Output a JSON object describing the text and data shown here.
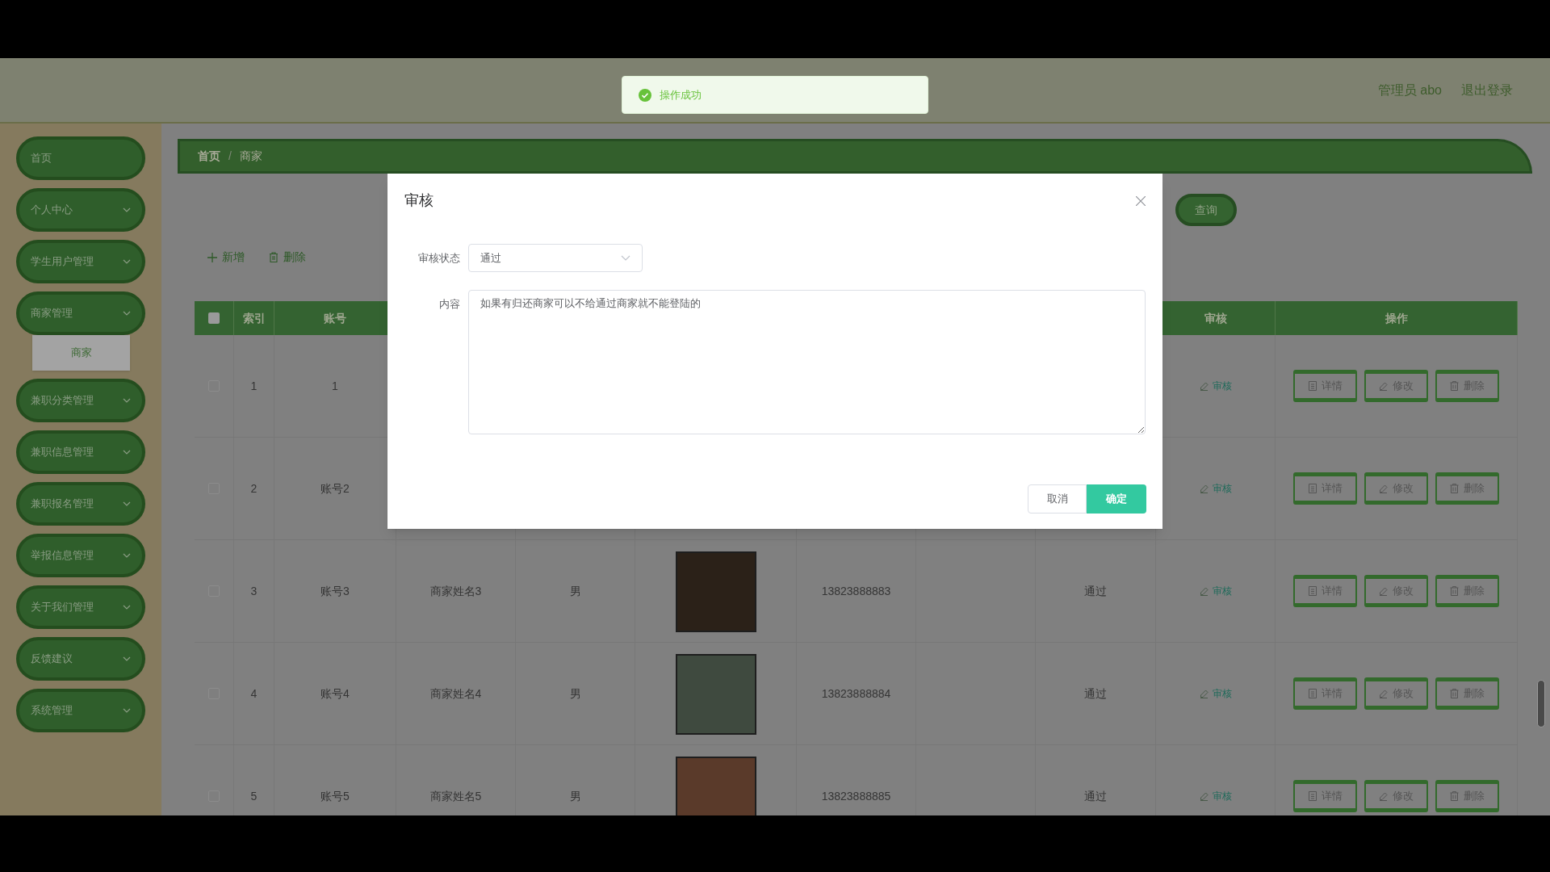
{
  "header": {
    "user": "管理员 abo",
    "logout": "退出登录"
  },
  "toast": {
    "message": "操作成功"
  },
  "sidebar": {
    "items": [
      {
        "label": "首页",
        "has_submenu": false
      },
      {
        "label": "个人中心",
        "has_submenu": true
      },
      {
        "label": "学生用户管理",
        "has_submenu": true
      },
      {
        "label": "商家管理",
        "has_submenu": true,
        "children": [
          {
            "label": "商家",
            "selected": true
          }
        ]
      },
      {
        "label": "兼职分类管理",
        "has_submenu": true
      },
      {
        "label": "兼职信息管理",
        "has_submenu": true
      },
      {
        "label": "兼职报名管理",
        "has_submenu": true
      },
      {
        "label": "举报信息管理",
        "has_submenu": true
      },
      {
        "label": "关于我们管理",
        "has_submenu": true
      },
      {
        "label": "反馈建议",
        "has_submenu": true
      },
      {
        "label": "系统管理",
        "has_submenu": true
      }
    ]
  },
  "breadcrumb": {
    "items": [
      "首页",
      "商家"
    ],
    "separator": "/"
  },
  "search": {
    "button": "查询"
  },
  "toolbar": {
    "add": "新增",
    "delete": "删除"
  },
  "table": {
    "select_all": {
      "checked": false
    },
    "columns": {
      "index": "索引",
      "account": "账号",
      "review": "审核",
      "actions": "操作"
    },
    "rows": [
      {
        "checked": false,
        "index": "1",
        "account": "1",
        "review": "审核",
        "actions": [
          "详情",
          "修改",
          "删除"
        ]
      },
      {
        "checked": false,
        "index": "2",
        "account": "账号2",
        "review": "审核",
        "actions": [
          "详情",
          "修改",
          "删除"
        ]
      },
      {
        "checked": false,
        "index": "3",
        "account": "账号3",
        "name": "商家姓名3",
        "gender": "男",
        "has_photo": true,
        "phone": "13823888883",
        "status": "通过",
        "review": "审核",
        "actions": [
          "详情",
          "修改",
          "删除"
        ]
      },
      {
        "checked": false,
        "index": "4",
        "account": "账号4",
        "name": "商家姓名4",
        "gender": "男",
        "has_photo": true,
        "phone": "13823888884",
        "status": "通过",
        "review": "审核",
        "actions": [
          "详情",
          "修改",
          "删除"
        ]
      },
      {
        "checked": false,
        "index": "5",
        "account": "账号5",
        "name": "商家姓名5",
        "gender": "男",
        "has_photo": true,
        "phone": "13823888885",
        "status": "通过",
        "review": "审核",
        "actions": [
          "详情",
          "修改",
          "删除"
        ]
      }
    ]
  },
  "dialog": {
    "title": "审核",
    "status_label": "审核状态",
    "status_value": "通过",
    "content_label": "内容",
    "content_value": "如果有归还商家可以不给通过商家就不能登陆的",
    "cancel": "取消",
    "confirm": "确定"
  }
}
